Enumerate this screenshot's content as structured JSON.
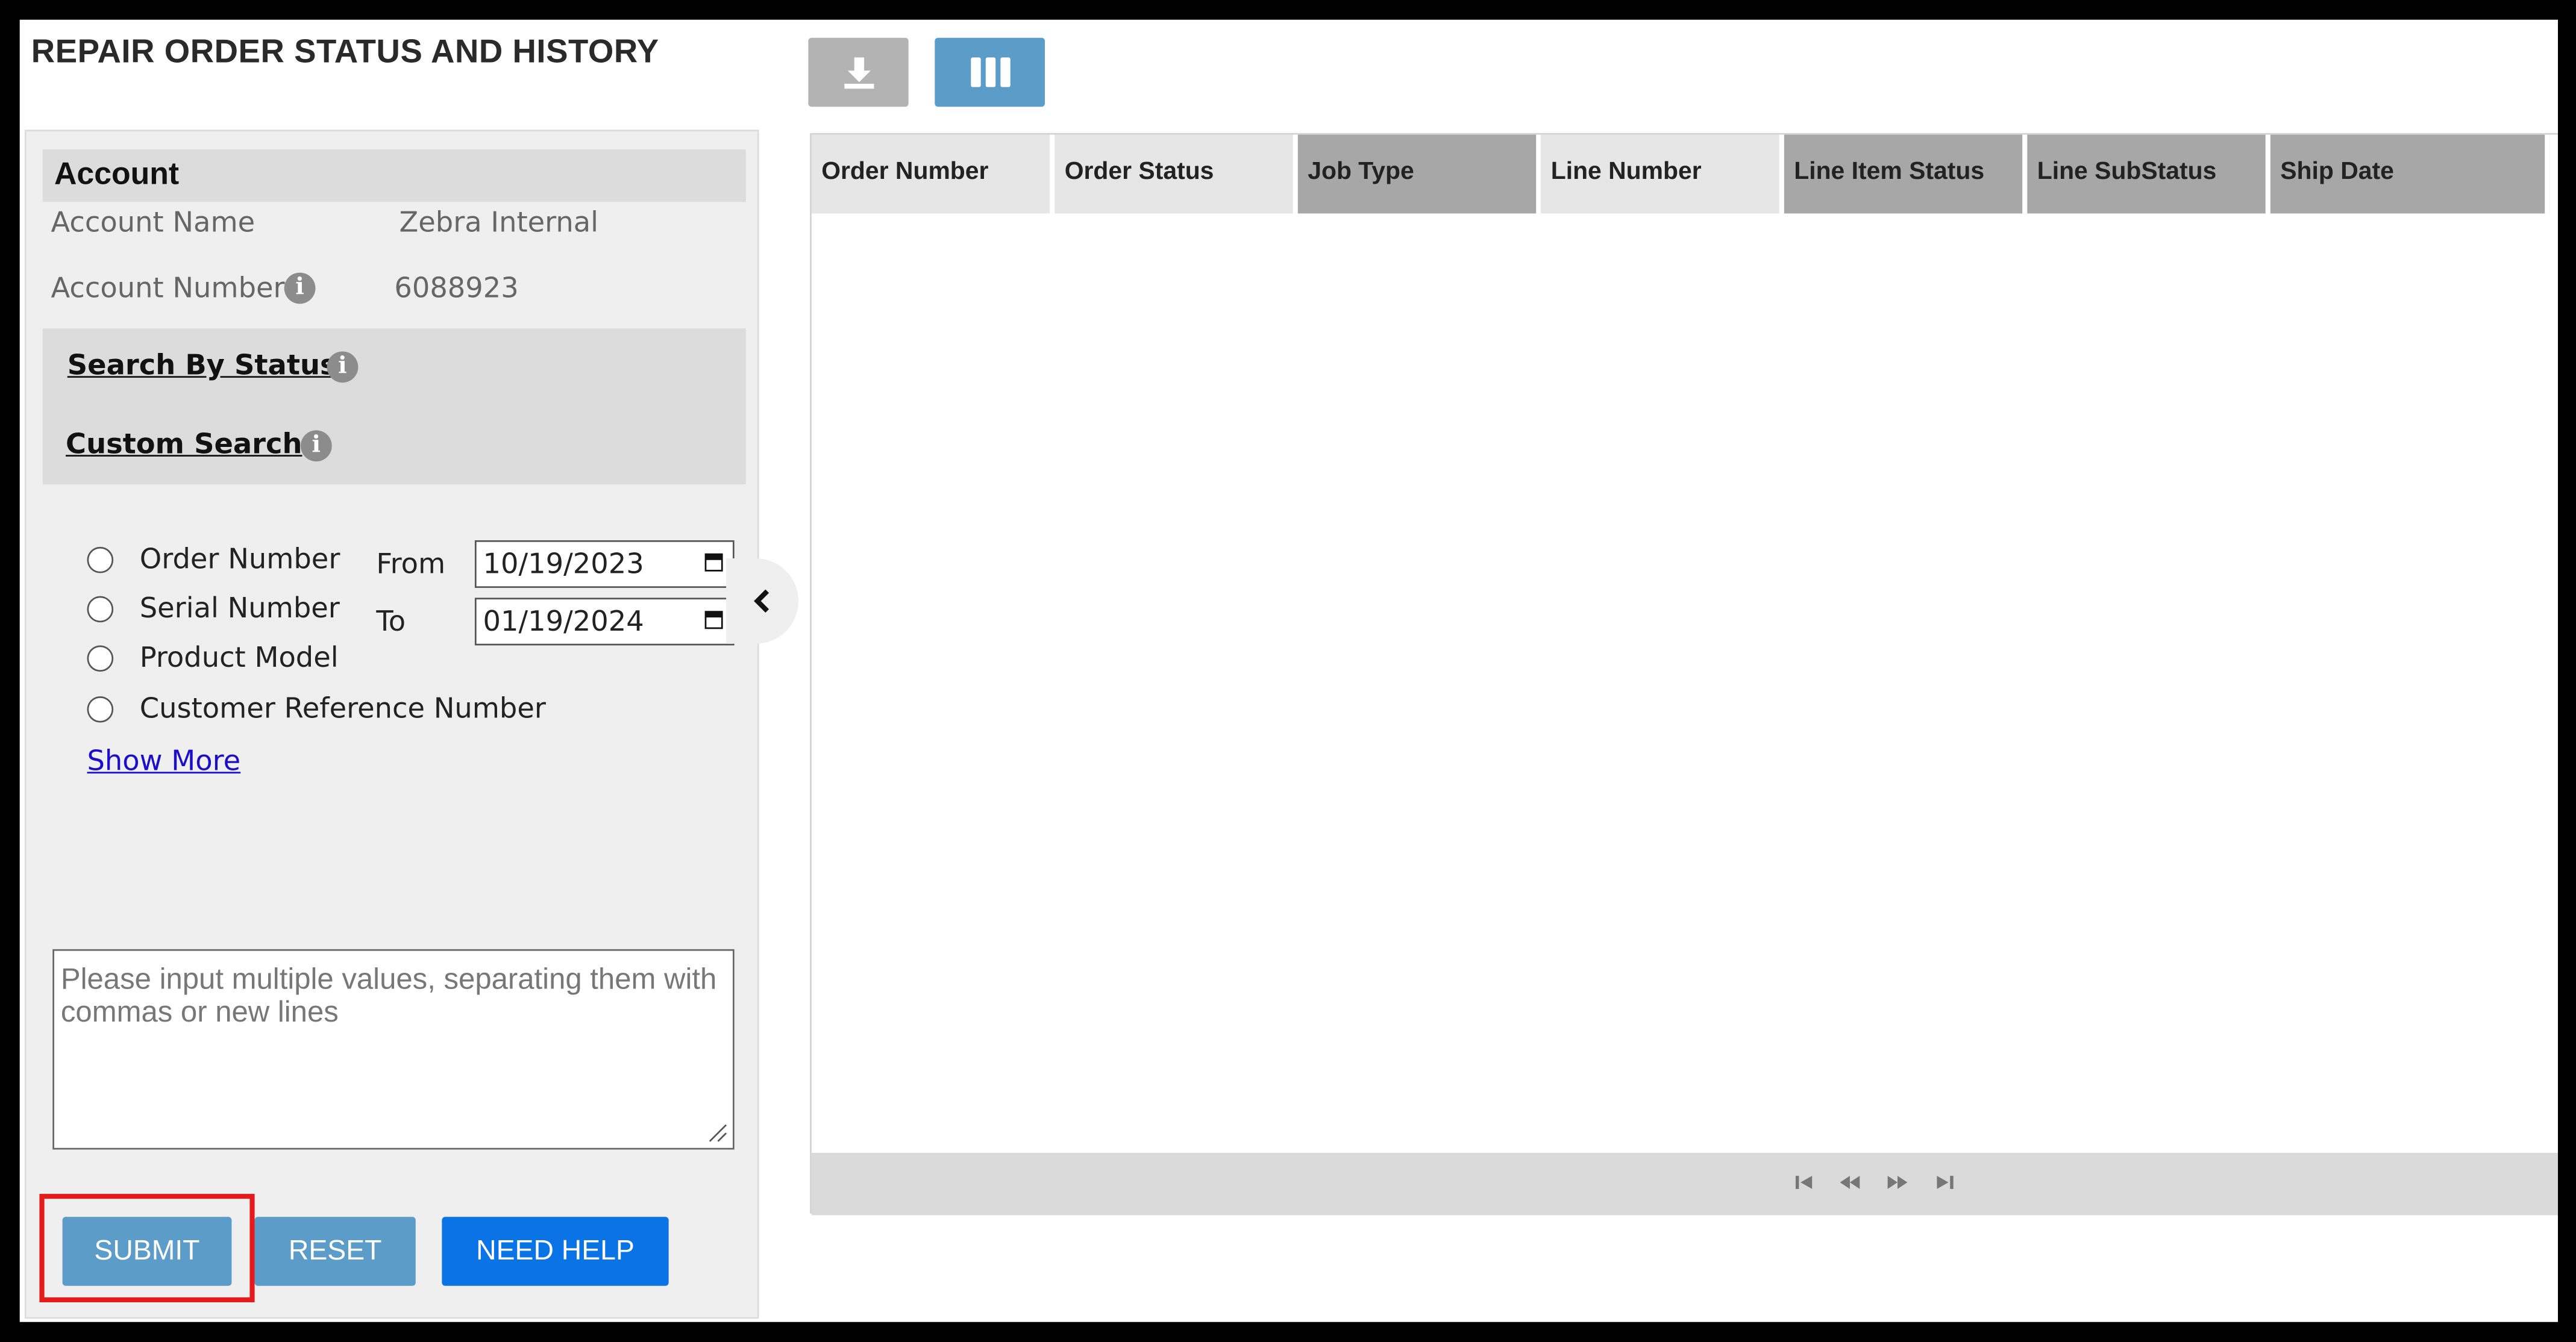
{
  "page": {
    "title": "REPAIR ORDER STATUS AND HISTORY"
  },
  "toolbar": {
    "download_icon": "download-icon",
    "columns_icon": "columns-icon"
  },
  "account": {
    "header": "Account",
    "name_label": "Account Name",
    "name_value": "Zebra Internal",
    "number_label": "Account Number",
    "number_value": "6088923"
  },
  "search": {
    "by_status": "Search By Status",
    "custom": "Custom Search"
  },
  "filters": {
    "options": [
      "Order Number",
      "Serial Number",
      "Product Model",
      "Customer Reference Number"
    ],
    "from_label": "From",
    "from_value": "10/19/2023",
    "to_label": "To",
    "to_value": "01/19/2024",
    "show_more": "Show More"
  },
  "multi_input": {
    "placeholder": "Please input multiple values, separating them with commas or new lines"
  },
  "actions": {
    "submit": "SUBMIT",
    "reset": "RESET",
    "help": "NEED HELP"
  },
  "grid": {
    "columns": [
      {
        "label": "Order Number",
        "sorted": false
      },
      {
        "label": "Order Status",
        "sorted": false
      },
      {
        "label": "Job Type",
        "sorted": true
      },
      {
        "label": "Line Number",
        "sorted": false
      },
      {
        "label": "Line Item Status",
        "sorted": true
      },
      {
        "label": "Line SubStatus",
        "sorted": true
      },
      {
        "label": "Ship Date",
        "sorted": true
      }
    ]
  },
  "colors": {
    "primary_button": "#5b9cc9",
    "help_button": "#0a73e5",
    "highlight": "#e51b1b",
    "link": "#1a0dcc"
  }
}
